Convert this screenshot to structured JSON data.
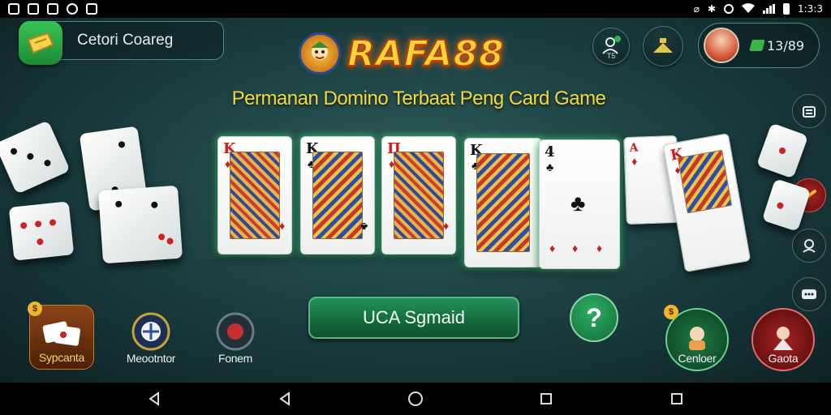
{
  "status_bar": {
    "time": "1:3:3",
    "left_icons": [
      "notification-icon",
      "image-icon",
      "image-icon",
      "game-icon",
      "message-icon"
    ],
    "right_icons": [
      "nfc-icon",
      "bluetooth-icon",
      "alarm-icon",
      "wifi-icon",
      "signal-icon",
      "battery-icon"
    ]
  },
  "promo": {
    "label": "Cetori Coareg",
    "icon": "ticket-icon",
    "color": "#2fb04e"
  },
  "logo": {
    "text": "RAFA88",
    "mascot_icon": "mascot-icon",
    "color": "#ffd335"
  },
  "subtitle": "Permanan Domino Terbaat Peng Card Game",
  "top_right": {
    "notifications_icon": "notification-person-icon",
    "notifications_badge": "",
    "notifications_sub": "T5",
    "store_icon": "store-icon",
    "profile": {
      "avatar_icon": "avatar-icon",
      "coins": "13/89",
      "coin_icon": "coin-icon"
    }
  },
  "side_rail": [
    {
      "name": "menu-icon",
      "active": false
    },
    {
      "name": "music-icon",
      "active": true
    },
    {
      "name": "support-icon",
      "active": false
    },
    {
      "name": "chat-icon",
      "active": false
    }
  ],
  "cards": [
    {
      "rank": "K",
      "suit": "♦",
      "color": "red"
    },
    {
      "rank": "K",
      "suit": "♣",
      "color": "blk"
    },
    {
      "rank": "Π",
      "suit": "♦",
      "color": "red"
    },
    {
      "rank": "K",
      "suit": "♣",
      "color": "blk"
    },
    {
      "rank": "4",
      "suit": "♣",
      "color": "blk"
    },
    {
      "rank": "A",
      "suit": "♦",
      "color": "red"
    },
    {
      "rank": "K",
      "suit": "♦",
      "color": "red"
    }
  ],
  "bottom_left": [
    {
      "label": "Sypcanta",
      "icon": "cards-icon",
      "badge": "$"
    },
    {
      "label": "Meootntor",
      "icon": "medal-icon"
    },
    {
      "label": "Fonem",
      "icon": "chip-icon"
    }
  ],
  "main_button": {
    "label": "UCA Sgmaid"
  },
  "help_button": {
    "label": "?"
  },
  "bottom_right": [
    {
      "label": "Cenloer",
      "icon": "character-icon",
      "badge": "$"
    },
    {
      "label": "Gaota",
      "icon": "warrior-icon"
    }
  ],
  "nav": [
    "back-icon",
    "back-icon",
    "home-icon",
    "recents-icon",
    "recents-icon"
  ]
}
